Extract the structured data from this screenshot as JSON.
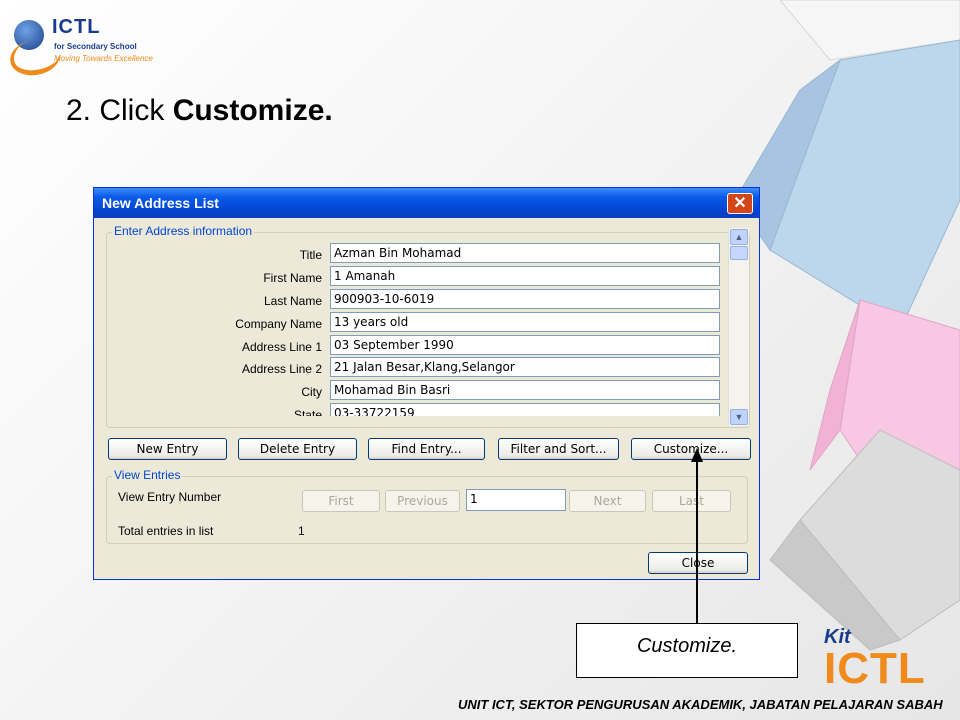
{
  "logo": {
    "title": "ICTL",
    "subtitle1": "for Secondary School",
    "subtitle2": "Moving Towards Excellence"
  },
  "slide": {
    "step_prefix": "2. Click ",
    "step_bold": "Customize."
  },
  "dialog": {
    "title": "New Address List",
    "group_enter": "Enter Address information",
    "fields": [
      {
        "label": "Title",
        "value": "Azman Bin Mohamad"
      },
      {
        "label": "First Name",
        "value": "1 Amanah"
      },
      {
        "label": "Last Name",
        "value": "900903-10-6019"
      },
      {
        "label": "Company Name",
        "value": "13 years old"
      },
      {
        "label": "Address Line 1",
        "value": "03 September 1990"
      },
      {
        "label": "Address Line 2",
        "value": "21 Jalan Besar,Klang,Selangor"
      },
      {
        "label": "City",
        "value": "Mohamad Bin Basri"
      },
      {
        "label": "State",
        "value": "03-33722159"
      }
    ],
    "buttons": {
      "new_entry": "New Entry",
      "delete_entry": "Delete Entry",
      "find_entry": "Find Entry...",
      "filter_sort": "Filter and Sort...",
      "customize": "Customize..."
    },
    "group_view": "View Entries",
    "view_entry_label": "View Entry Number",
    "nav": {
      "first": "First",
      "previous": "Previous",
      "entry_value": "1",
      "next": "Next",
      "last": "Last"
    },
    "total_label": "Total entries in list",
    "total_value": "1",
    "close": "Close"
  },
  "callout": "Customize.",
  "footer": "UNIT ICT, SEKTOR PENGURUSAN AKADEMIK, JABATAN PELAJARAN SABAH",
  "kit_logo": {
    "top": "Kit",
    "main": "ICTL"
  },
  "colors": {
    "titlebar": "#0a5ae8",
    "accent_blue": "#0046d5",
    "orange": "#f08a1c"
  }
}
